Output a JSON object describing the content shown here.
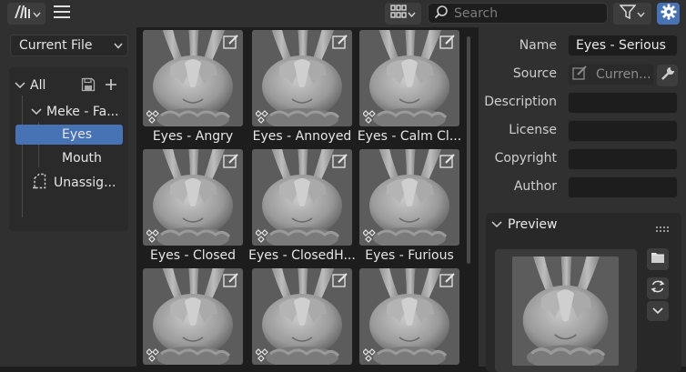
{
  "header": {
    "search_placeholder": "Search"
  },
  "sidebar": {
    "source_select": "Current File",
    "tree": {
      "all": "All",
      "catalog": "Meke - Fa...",
      "children": [
        "Eyes",
        "Mouth"
      ],
      "unassigned": "Unassig..."
    }
  },
  "assets": [
    {
      "name": "Eyes - Angry"
    },
    {
      "name": "Eyes - Annoyed"
    },
    {
      "name": "Eyes - Calm Cl..."
    },
    {
      "name": "Eyes - Closed"
    },
    {
      "name": "Eyes - ClosedH..."
    },
    {
      "name": "Eyes - Furious"
    },
    {
      "name": ""
    },
    {
      "name": ""
    },
    {
      "name": ""
    }
  ],
  "properties": {
    "name_label": "Name",
    "name_value": "Eyes - Serious",
    "source_label": "Source",
    "source_value": "Curren...",
    "description_label": "Description",
    "description_value": "",
    "license_label": "License",
    "license_value": "",
    "copyright_label": "Copyright",
    "copyright_value": "",
    "author_label": "Author",
    "author_value": ""
  },
  "preview": {
    "title": "Preview"
  },
  "colors": {
    "accent": "#4772b3",
    "panel": "#303030",
    "background": "#1d1d1d",
    "thumbnail": "#5a5a5a"
  }
}
